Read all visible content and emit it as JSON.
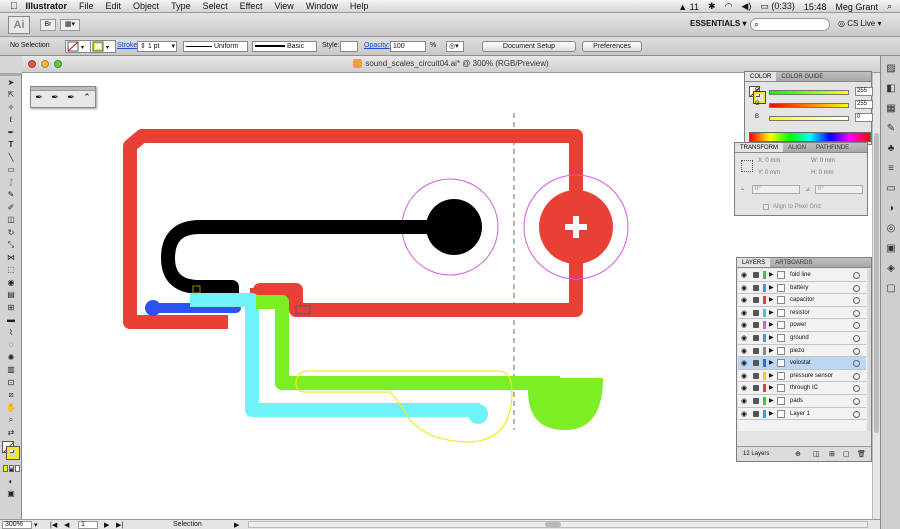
{
  "menubar": {
    "apple": "",
    "app_name": "Illustrator",
    "items": [
      "File",
      "Edit",
      "Object",
      "Type",
      "Select",
      "Effect",
      "View",
      "Window",
      "Help"
    ],
    "status": {
      "adobe_badge": "11",
      "battery": "(0:33)",
      "clock": "15:48",
      "user": "Meg Grant"
    }
  },
  "appbar": {
    "logo": "Ai",
    "workspace": "ESSENTIALS ▾",
    "cs_live": "CS Live ▾"
  },
  "control": {
    "selection": "No Selection",
    "stroke_label": "Stroke:",
    "stroke_weight": "1 pt",
    "profile": "Uniform",
    "brush": "Basic",
    "style_label": "Style:",
    "opacity_label": "Opacity:",
    "opacity_value": "100",
    "opacity_unit": "%",
    "document_setup": "Document Setup",
    "preferences": "Preferences"
  },
  "document": {
    "title": "sound_scales_circuit04.ai* @ 300% (RGB/Preview)"
  },
  "color_panel": {
    "tabs": [
      "COLOR",
      "COLOR GUIDE"
    ],
    "channels": [
      {
        "label": "R",
        "value": "255"
      },
      {
        "label": "G",
        "value": "255"
      },
      {
        "label": "B",
        "value": "0"
      }
    ],
    "colors": {
      "r": "#e84030",
      "g": "#7ed321",
      "b": "#3a60f0"
    }
  },
  "transform_panel": {
    "tabs": [
      "TRANSFORM",
      "ALIGN",
      "PATHFINDE"
    ],
    "x": "X: 0 mm",
    "y": "Y: 0 mm",
    "w": "W: 0 mm",
    "h": "H: 0 mm",
    "rotate": "0°",
    "shear": "0°",
    "align_pixel": "Align to Pixel Grid"
  },
  "layers_panel": {
    "tabs": [
      "LAYERS",
      "ARTBOARDS"
    ],
    "layers": [
      {
        "name": "fold line",
        "color": "#3cc83c"
      },
      {
        "name": "battery",
        "color": "#3a9ae0"
      },
      {
        "name": "capacitor",
        "color": "#e84030"
      },
      {
        "name": "resistor",
        "color": "#2ad0d0"
      },
      {
        "name": "power",
        "color": "#d060e0"
      },
      {
        "name": "ground",
        "color": "#3a9ae0"
      },
      {
        "name": "piezo",
        "color": "#8a8a8a"
      },
      {
        "name": "velostat",
        "color": "#3a60f0"
      },
      {
        "name": "pressure sensor",
        "color": "#e8d020"
      },
      {
        "name": "through IC",
        "color": "#e84030"
      },
      {
        "name": "pads",
        "color": "#3cc83c"
      },
      {
        "name": "Layer 1",
        "color": "#3a9ae0"
      }
    ],
    "selected": "velostat",
    "count": "12 Layers"
  },
  "status": {
    "zoom": "300%",
    "artboard": "1",
    "tool": "Selection"
  },
  "art_colors": {
    "red": "#e84034",
    "black": "#000000",
    "cyan": "#6ef4f8",
    "green": "#7cee24",
    "blue": "#2e52f2",
    "yellow": "#f2ea1c",
    "magenta": "#d35be0"
  },
  "icons": {
    "plus": "plus-icon",
    "eye": "eye-icon",
    "lock": "lock-icon"
  }
}
